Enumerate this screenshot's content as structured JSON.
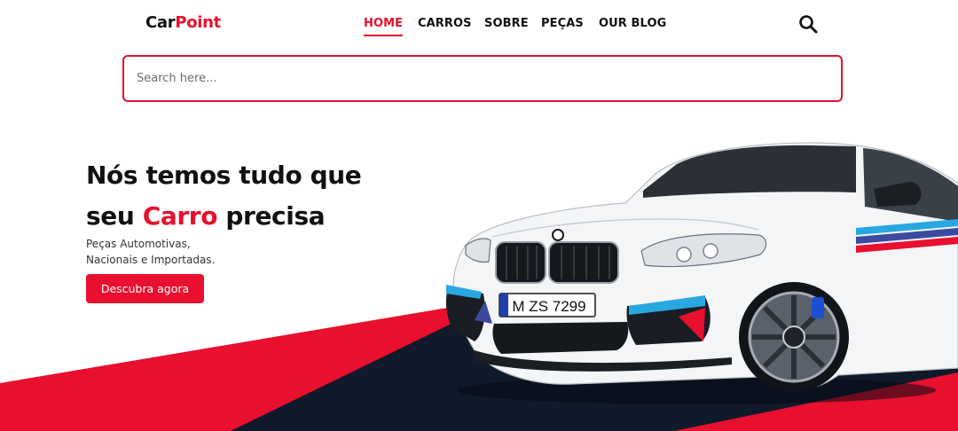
{
  "brand": {
    "part1": "Car",
    "part2": "Point"
  },
  "nav": {
    "items": [
      {
        "label": "HOME",
        "active": true
      },
      {
        "label": "CARROS",
        "active": false
      },
      {
        "label": "SOBRE",
        "active": false
      },
      {
        "label": "PEÇAS",
        "active": false
      },
      {
        "label": "OUR BLOG",
        "active": false
      }
    ]
  },
  "search": {
    "placeholder": "Search here...",
    "value": ""
  },
  "hero": {
    "title_line1": "Nós temos tudo que",
    "title_line2_pre": "seu ",
    "title_line2_highlight": "Carro",
    "title_line2_post": " precisa",
    "subtitle_line1": "Peças Automotivas,",
    "subtitle_line2": "Nacionais e Importadas.",
    "cta_label": "Descubra agora"
  },
  "car": {
    "plate": "M ZS 7299"
  },
  "colors": {
    "accent": "#e8102e",
    "dark": "#101a2b",
    "text": "#111111"
  },
  "icons": {
    "search": "search-icon",
    "car": "car-illustration"
  }
}
